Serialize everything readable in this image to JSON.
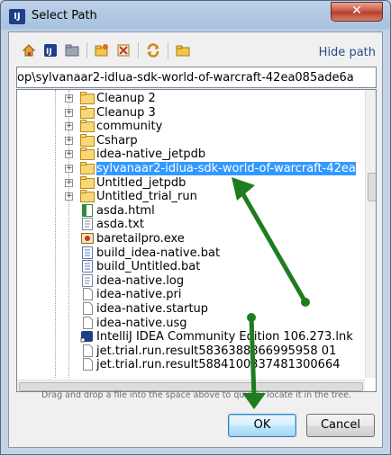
{
  "window": {
    "title": "Select Path"
  },
  "toolbar": {
    "buttons": [
      "home-icon",
      "project-icon",
      "module-icon",
      "new-folder-icon",
      "delete-icon",
      "refresh-icon",
      "show-hidden-icon"
    ],
    "hide_path_label": "Hide path"
  },
  "path": {
    "value": "op\\sylvanaar2-idlua-sdk-world-of-warcraft-42ea085ade6a"
  },
  "tree": {
    "items": [
      {
        "label": "Cleanup 2",
        "type": "folder"
      },
      {
        "label": "Cleanup 3",
        "type": "folder"
      },
      {
        "label": "community",
        "type": "folder"
      },
      {
        "label": "Csharp",
        "type": "folder"
      },
      {
        "label": "idea-native_jetpdb",
        "type": "folder"
      },
      {
        "label": "sylvanaar2-idlua-sdk-world-of-warcraft-42ea",
        "type": "folder",
        "selected": true
      },
      {
        "label": "Untitled_jetpdb",
        "type": "folder"
      },
      {
        "label": "Untitled_trial_run",
        "type": "folder"
      },
      {
        "label": "asda.html",
        "type": "html"
      },
      {
        "label": "asda.txt",
        "type": "text"
      },
      {
        "label": "baretailpro.exe",
        "type": "exe"
      },
      {
        "label": "build_idea-native.bat",
        "type": "bat"
      },
      {
        "label": "build_Untitled.bat",
        "type": "bat"
      },
      {
        "label": "idea-native.log",
        "type": "text"
      },
      {
        "label": "idea-native.pri",
        "type": "file"
      },
      {
        "label": "idea-native.startup",
        "type": "file"
      },
      {
        "label": "idea-native.usg",
        "type": "file"
      },
      {
        "label": "IntelliJ IDEA Community Edition 106.273.lnk",
        "type": "lnk"
      },
      {
        "label": "jet.trial.run.result5836388866995958 01",
        "type": "file"
      },
      {
        "label": "jet.trial.run.result5884100337481300664",
        "type": "file"
      }
    ]
  },
  "hint": "Drag and drop a file into the space above to quickly locate it in the tree.",
  "buttons": {
    "ok": "OK",
    "cancel": "Cancel"
  },
  "annotation_color": "#1e7d1e"
}
